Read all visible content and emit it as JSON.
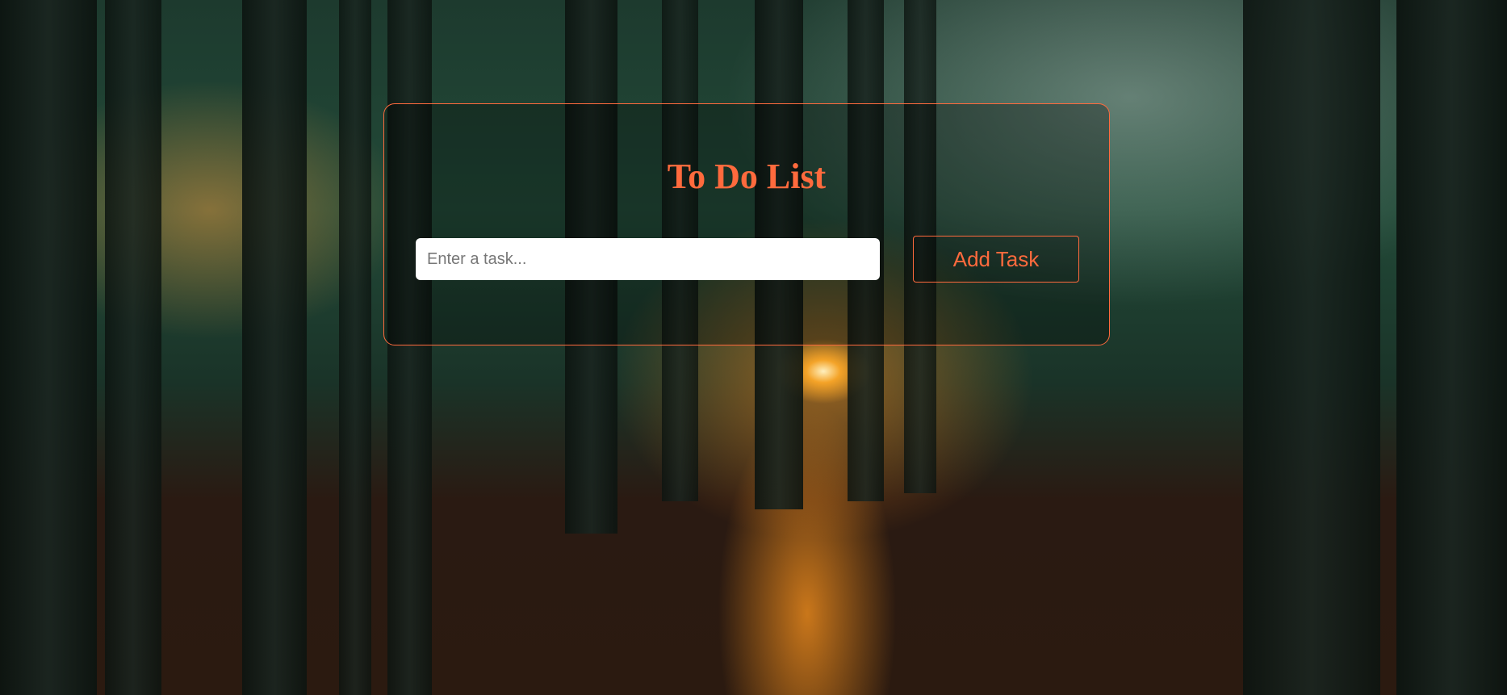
{
  "app": {
    "title": "To Do List"
  },
  "task_form": {
    "input_placeholder": "Enter a task...",
    "input_value": "",
    "add_label": "Add Task"
  },
  "colors": {
    "accent": "#ff6a3d",
    "input_background": "#ffffff"
  },
  "background": {
    "image": "forest-sunset-photo"
  }
}
